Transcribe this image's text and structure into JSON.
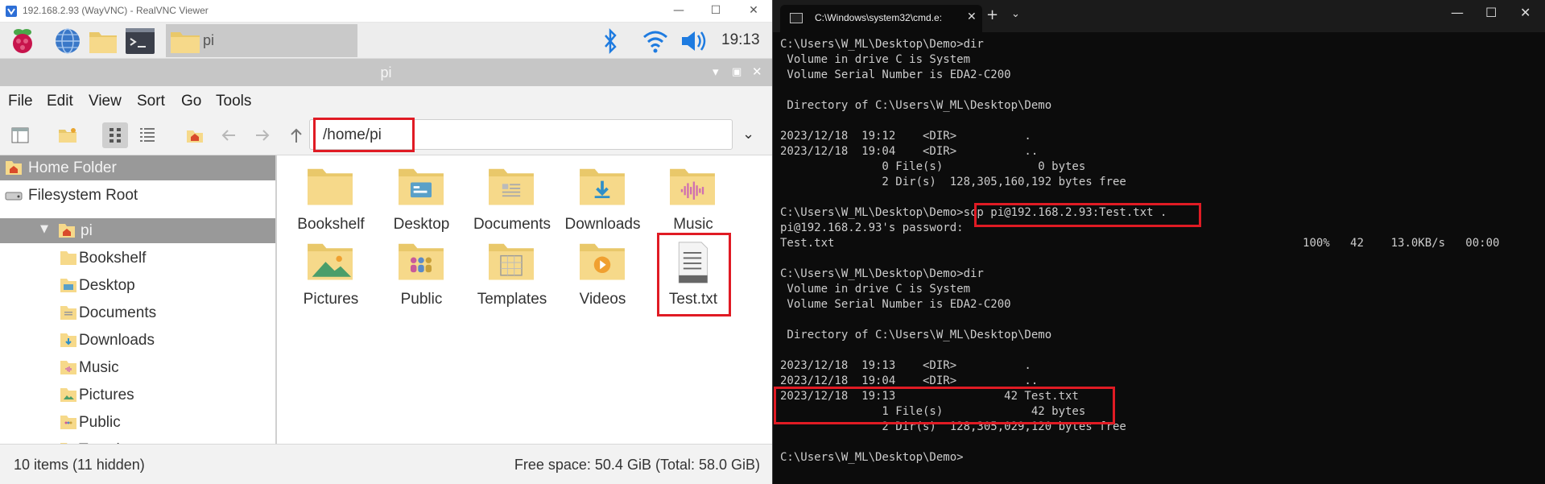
{
  "vnc": {
    "window_title": "192.168.2.93 (WayVNC) - RealVNC Viewer",
    "panel": {
      "task_label": "pi",
      "clock": "19:13"
    },
    "file_manager": {
      "title": "pi",
      "menu": [
        "File",
        "Edit",
        "View",
        "Sort",
        "Go",
        "Tools"
      ],
      "path": "/home/pi",
      "sidebar": {
        "home": "Home Folder",
        "fs_root": "Filesystem Root",
        "pi": "pi",
        "items": [
          "Bookshelf",
          "Desktop",
          "Documents",
          "Downloads",
          "Music",
          "Pictures",
          "Public",
          "Templates"
        ]
      },
      "files": [
        {
          "name": "Bookshelf",
          "icon": "folder"
        },
        {
          "name": "Desktop",
          "icon": "folder-desktop"
        },
        {
          "name": "Documents",
          "icon": "folder-documents"
        },
        {
          "name": "Downloads",
          "icon": "folder-downloads"
        },
        {
          "name": "Music",
          "icon": "folder-music"
        },
        {
          "name": "Pictures",
          "icon": "folder-pictures"
        },
        {
          "name": "Public",
          "icon": "folder-public"
        },
        {
          "name": "Templates",
          "icon": "folder-templates"
        },
        {
          "name": "Videos",
          "icon": "folder-videos"
        },
        {
          "name": "Test.txt",
          "icon": "text-file"
        }
      ],
      "status_left": "10 items (11 hidden)",
      "status_right": "Free space: 50.4 GiB (Total: 58.0 GiB)"
    }
  },
  "cmd": {
    "tab_title": "C:\\Windows\\system32\\cmd.e:",
    "lines": [
      "C:\\Users\\W_ML\\Desktop\\Demo>dir",
      " Volume in drive C is System",
      " Volume Serial Number is EDA2-C200",
      "",
      " Directory of C:\\Users\\W_ML\\Desktop\\Demo",
      "",
      "2023/12/18  19:12    <DIR>          .",
      "2023/12/18  19:04    <DIR>          ..",
      "               0 File(s)              0 bytes",
      "               2 Dir(s)  128,305,160,192 bytes free",
      "",
      "C:\\Users\\W_ML\\Desktop\\Demo>scp pi@192.168.2.93:Test.txt .",
      "pi@192.168.2.93's password:",
      "Test.txt                                                                     100%   42    13.0KB/s   00:00",
      "",
      "C:\\Users\\W_ML\\Desktop\\Demo>dir",
      " Volume in drive C is System",
      " Volume Serial Number is EDA2-C200",
      "",
      " Directory of C:\\Users\\W_ML\\Desktop\\Demo",
      "",
      "2023/12/18  19:13    <DIR>          .",
      "2023/12/18  19:04    <DIR>          ..",
      "2023/12/18  19:13                42 Test.txt",
      "               1 File(s)             42 bytes",
      "               2 Dir(s)  128,305,029,120 bytes free",
      "",
      "C:\\Users\\W_ML\\Desktop\\Demo>"
    ]
  },
  "colors": {
    "highlight": "#e01b24",
    "folder": "#f6d98a",
    "terminal_bg": "#0c0c0c",
    "terminal_text": "#cccccc"
  }
}
